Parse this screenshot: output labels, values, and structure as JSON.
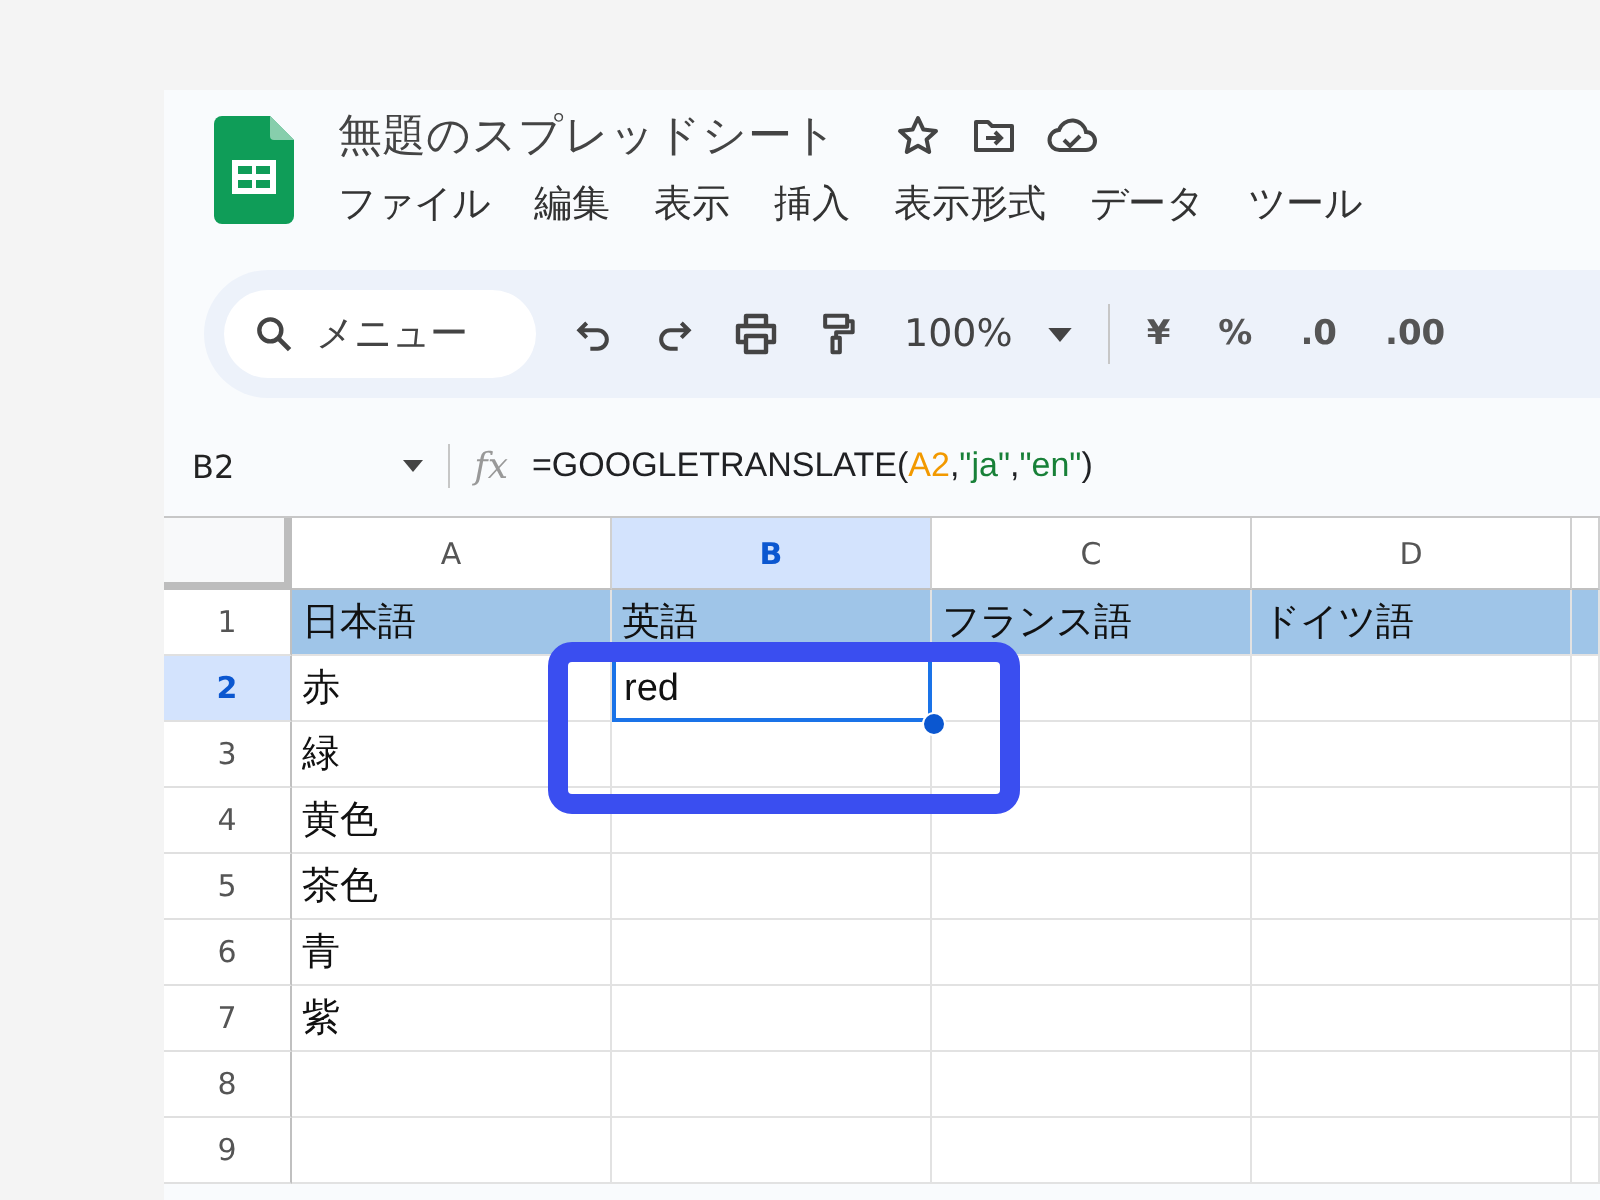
{
  "document": {
    "title": "無題のスプレッドシート"
  },
  "menu": [
    "ファイル",
    "編集",
    "表示",
    "挿入",
    "表示形式",
    "データ",
    "ツール"
  ],
  "toolbar": {
    "search_placeholder": "メニュー",
    "zoom": "100%",
    "format_buttons": [
      "¥",
      "%",
      ".0",
      ".00"
    ]
  },
  "formula_bar": {
    "name_box": "B2",
    "fx_label": "fx",
    "formula": [
      {
        "kind": "plain",
        "text": "=GOOGLETRANSLATE("
      },
      {
        "kind": "ref",
        "text": "A2"
      },
      {
        "kind": "plain",
        "text": ","
      },
      {
        "kind": "string",
        "text": "\"ja\""
      },
      {
        "kind": "plain",
        "text": ","
      },
      {
        "kind": "string",
        "text": "\"en\""
      },
      {
        "kind": "plain",
        "text": ")"
      }
    ]
  },
  "columns": [
    {
      "label": "A",
      "selected": false
    },
    {
      "label": "B",
      "selected": true
    },
    {
      "label": "C",
      "selected": false
    },
    {
      "label": "D",
      "selected": false
    }
  ],
  "rows": [
    {
      "number": "1",
      "kind": "header",
      "selected": false,
      "cells": [
        {
          "text": "日本語",
          "selected": false
        },
        {
          "text": "英語",
          "selected": false
        },
        {
          "text": "フランス語",
          "selected": false
        },
        {
          "text": "ドイツ語",
          "selected": false
        }
      ]
    },
    {
      "number": "2",
      "kind": "data",
      "selected": true,
      "cells": [
        {
          "text": "赤",
          "selected": false
        },
        {
          "text": "red",
          "selected": true
        }
      ]
    },
    {
      "number": "3",
      "kind": "data",
      "selected": false,
      "cells": [
        {
          "text": "緑",
          "selected": false
        }
      ]
    },
    {
      "number": "4",
      "kind": "data",
      "selected": false,
      "cells": [
        {
          "text": "黄色",
          "selected": false
        }
      ]
    },
    {
      "number": "5",
      "kind": "data",
      "selected": false,
      "cells": [
        {
          "text": "茶色",
          "selected": false
        }
      ]
    },
    {
      "number": "6",
      "kind": "data",
      "selected": false,
      "cells": [
        {
          "text": "青",
          "selected": false
        }
      ]
    },
    {
      "number": "7",
      "kind": "data",
      "selected": false,
      "cells": [
        {
          "text": "紫",
          "selected": false
        }
      ]
    },
    {
      "number": "8",
      "kind": "data",
      "selected": false,
      "cells": []
    },
    {
      "number": "9",
      "kind": "data",
      "selected": false,
      "cells": []
    }
  ],
  "annotation": {
    "kind": "highlight-frame"
  }
}
